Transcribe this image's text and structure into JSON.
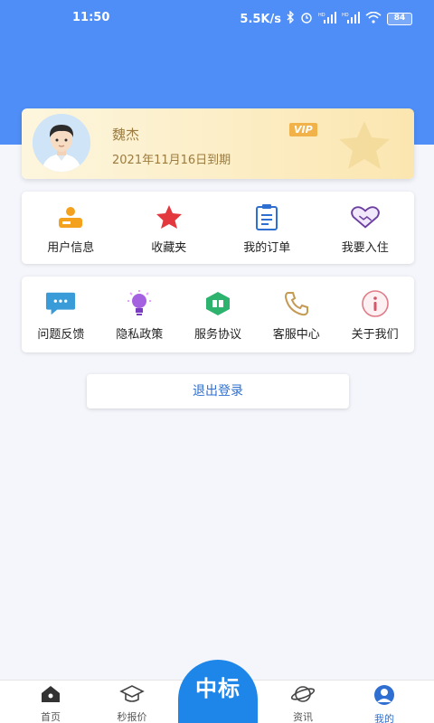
{
  "status_bar": {
    "time": "11:50",
    "speed": "5.5K/s",
    "battery": "84"
  },
  "member": {
    "name": "魏杰",
    "vip_label": "VIP",
    "expire": "2021年11月16日到期"
  },
  "menu_primary": [
    {
      "label": "用户信息",
      "icon": "user-card-icon"
    },
    {
      "label": "收藏夹",
      "icon": "star-icon"
    },
    {
      "label": "我的订单",
      "icon": "clipboard-icon"
    },
    {
      "label": "我要入住",
      "icon": "handshake-icon"
    }
  ],
  "menu_secondary": [
    {
      "label": "问题反馈",
      "icon": "chat-bubble-icon"
    },
    {
      "label": "隐私政策",
      "icon": "lightbulb-icon"
    },
    {
      "label": "服务协议",
      "icon": "book-icon"
    },
    {
      "label": "客服中心",
      "icon": "phone-icon"
    },
    {
      "label": "关于我们",
      "icon": "info-icon"
    }
  ],
  "logout_label": "退出登录",
  "bottom_nav": {
    "home": "首页",
    "quote": "秒报价",
    "center": "中标",
    "news": "资讯",
    "mine": "我的"
  },
  "colors": {
    "header_blue": "#4f8ef7",
    "accent_blue": "#2f6fd1",
    "center_button": "#1e86e8",
    "gold_text": "#9b7b3f"
  }
}
